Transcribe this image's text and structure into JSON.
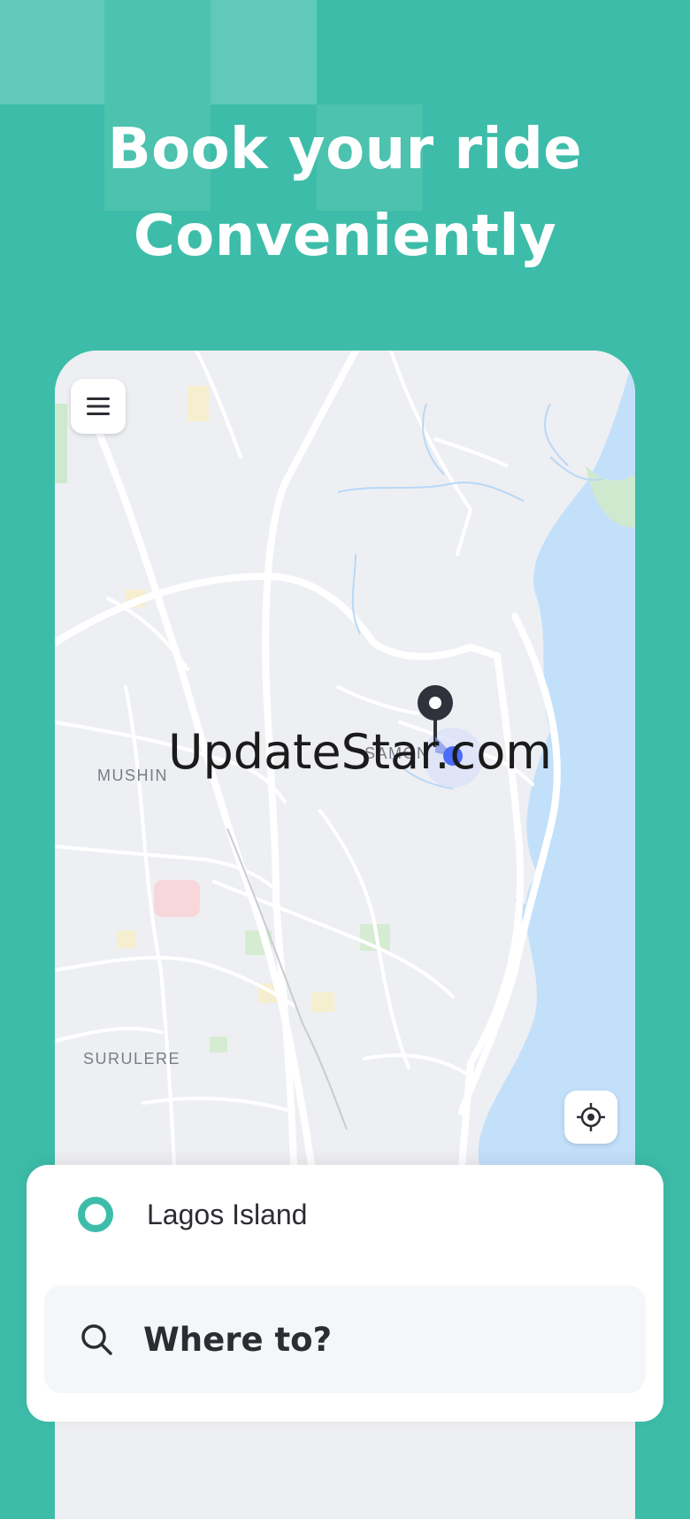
{
  "headline": {
    "line1": "Book your ride",
    "line2": "Conveniently"
  },
  "map": {
    "labels": {
      "mushin": "MUSHIN",
      "surulere": "SURULERE",
      "samonda": "SAMON"
    },
    "watermark": "UpdateStar.com",
    "menu_icon": "hamburger-menu-icon",
    "locate_icon": "crosshair-locate-icon"
  },
  "booking": {
    "origin": "Lagos Island",
    "destination_placeholder": "Where to?"
  },
  "colors": {
    "brand": "#3dbda9",
    "water": "#c3e0fb",
    "map_bg": "#eeeff3",
    "pin": "#2f323a",
    "user_dot": "#4a6cf7"
  }
}
